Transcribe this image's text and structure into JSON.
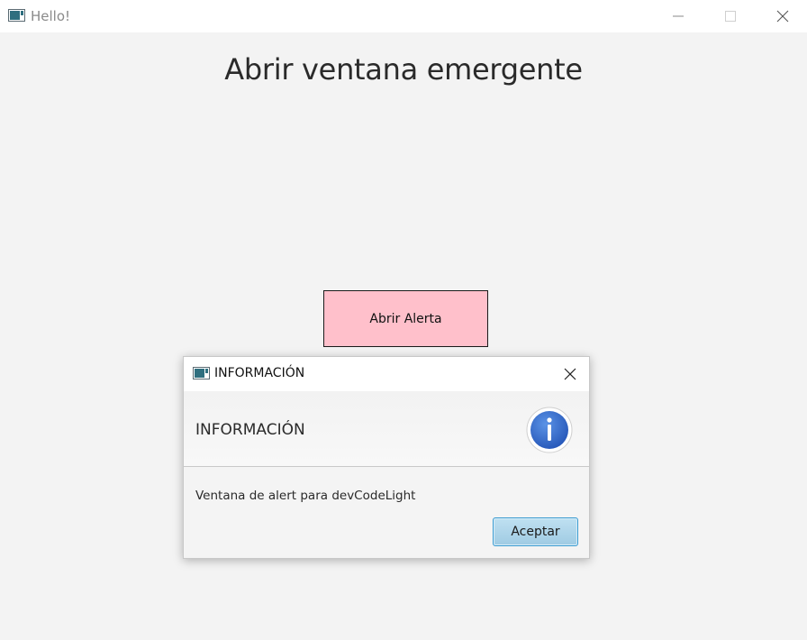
{
  "window": {
    "title": "Hello!"
  },
  "main": {
    "heading": "Abrir ventana emergente",
    "alert_button_label": "Abrir Alerta",
    "alert_button_color": "#ffc0cb"
  },
  "dialog": {
    "title": "INFORMACIÓN",
    "header_text": "INFORMACIÓN",
    "content_text": "Ventana de alert para devCodeLight",
    "accept_label": "Aceptar",
    "icon": "info-icon",
    "accent_color": "#3a7bd5"
  }
}
